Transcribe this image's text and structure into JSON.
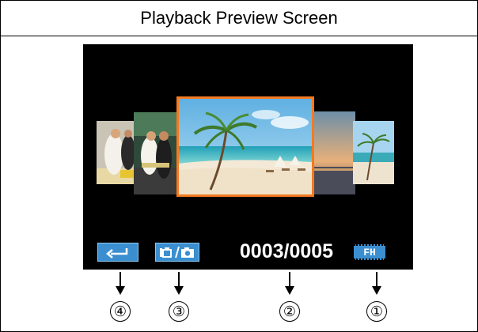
{
  "header": {
    "title": "Playback Preview Screen"
  },
  "screen": {
    "counter": "0003/0005",
    "resolution_badge": "FH",
    "back_icon": "return-arrow-icon",
    "mode_icon": "video-photo-toggle-icon",
    "selected_thumbnail_border": "#f47a20",
    "button_color": "#3b8fd0"
  },
  "callouts": [
    "④",
    "③",
    "②",
    "①"
  ]
}
